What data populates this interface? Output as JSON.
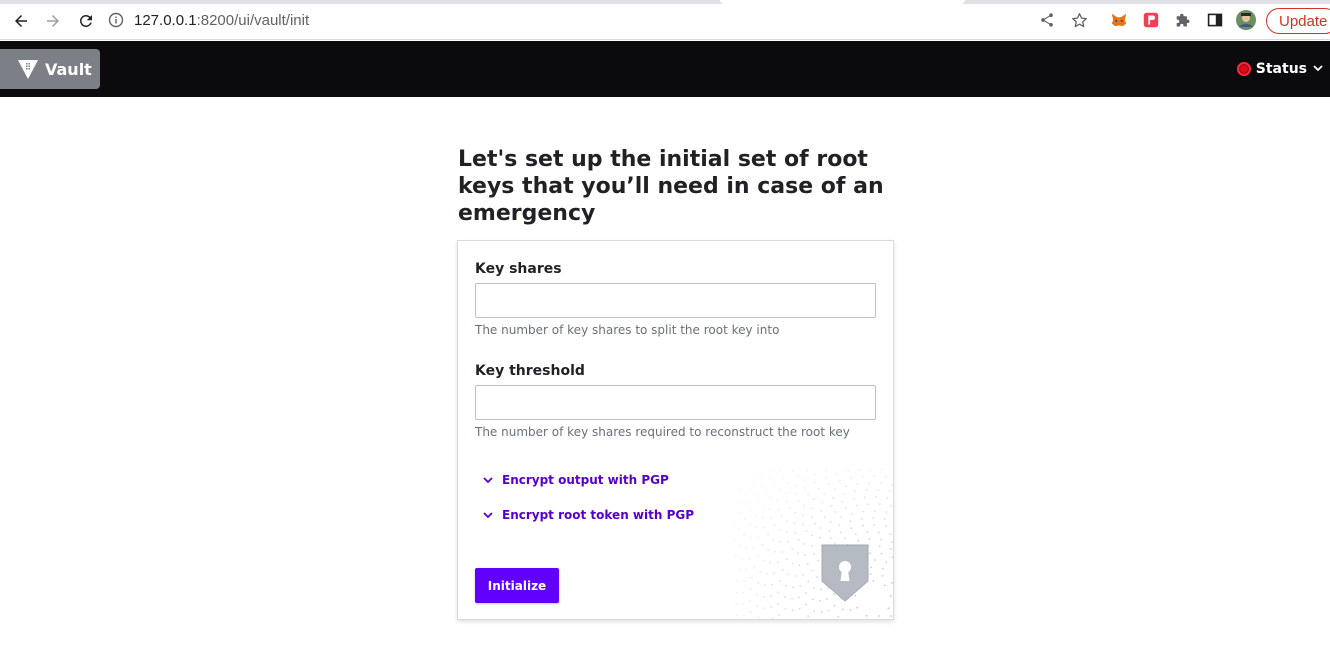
{
  "browser": {
    "url_host": "127.0.0.1",
    "url_rest": ":8200/ui/vault/init",
    "update_label": "Update"
  },
  "header": {
    "brand": "Vault",
    "status_label": "Status",
    "status_color": "#e00a1e"
  },
  "page": {
    "title": "Let's set up the initial set of root keys that you’ll need in case of an emergency"
  },
  "form": {
    "key_shares": {
      "label": "Key shares",
      "value": "",
      "help": "The number of key shares to split the root key into"
    },
    "key_threshold": {
      "label": "Key threshold",
      "value": "",
      "help": "The number of key shares required to reconstruct the root key"
    },
    "toggles": {
      "encrypt_output": "Encrypt output with PGP",
      "encrypt_root_token": "Encrypt root token with PGP"
    },
    "submit_label": "Initialize"
  },
  "colors": {
    "accent": "#6200ff",
    "link": "#5700cc",
    "header_bg": "#0b0b0d"
  }
}
